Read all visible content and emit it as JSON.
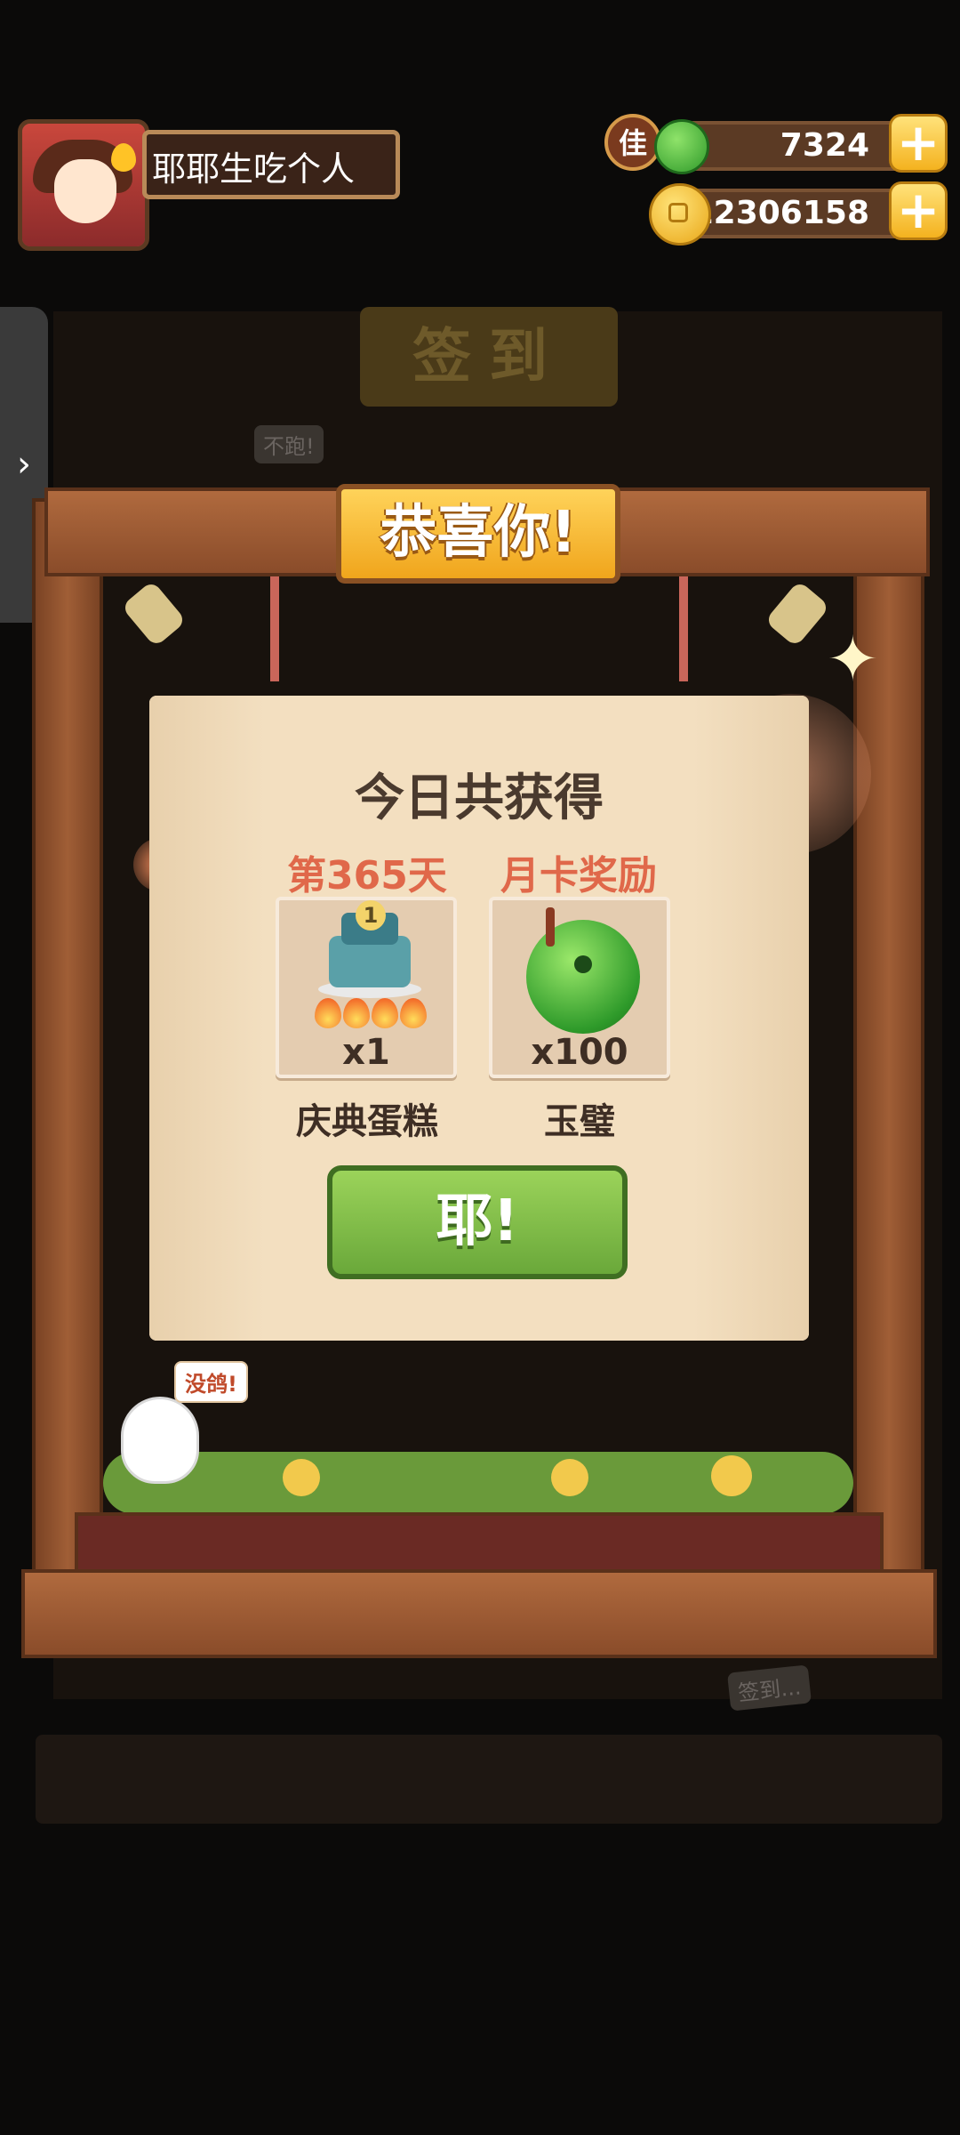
{
  "player": {
    "name": "耶耶生吃个人",
    "vip_label": "佳"
  },
  "resources": {
    "jade": "7324",
    "coins": "12306158",
    "add_symbol": "+"
  },
  "side_tab": {
    "arrow": "›"
  },
  "background": {
    "title": "签到",
    "bubble_top": "不跑!",
    "bubble_bottom": "没鸽!",
    "sign_bottom": "签到..."
  },
  "banner": {
    "text": "恭喜你!"
  },
  "dialog": {
    "title": "今日共获得",
    "rewards": [
      {
        "header": "第365天",
        "qty": "x1",
        "name": "庆典蛋糕",
        "cake_badge": "1"
      },
      {
        "header": "月卡奖励",
        "qty": "x100",
        "name": "玉璧"
      }
    ],
    "confirm": "耶!"
  },
  "colors": {
    "accent_orange": "#e0684a",
    "confirm_green": "#6aa83a",
    "banner_gold": "#f0a51c",
    "wood": "#8a4c2a"
  }
}
